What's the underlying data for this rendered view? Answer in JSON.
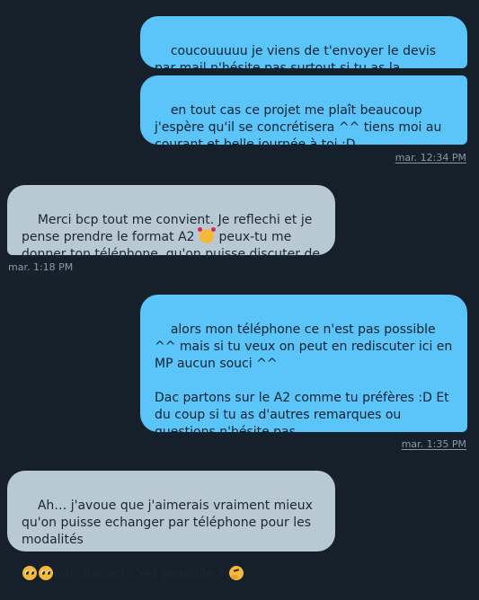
{
  "messages": [
    {
      "direction": "outgoing",
      "text": "coucouuuuu je viens de t'envoyer le devis par mail n'hésite pas surtout si tu as la moindre question :D"
    },
    {
      "direction": "outgoing",
      "text": "en tout cas ce projet me plaît beaucoup j'espère qu'il se concrétisera ^^ tiens moi au courant et belle journée à toi :D",
      "timestamp": "mar. 12:34 PM"
    },
    {
      "direction": "incoming",
      "text_before_emoji": "Merci bcp tout me convient. Je reflechi et je pense prendre le format A2 ",
      "emoji_1": "smiling-face-with-hearts",
      "text_after_emoji": " peux-tu me donner ton téléphone  qu'on puisse discuter de tout ca ?",
      "timestamp": "mar. 1:18 PM"
    },
    {
      "direction": "outgoing",
      "text": "alors mon téléphone ce n'est pas possible ^^ mais si tu veux on peut en rediscuter ici en MP aucun souci ^^\n\nDac partons sur le A2 comme tu préfères :D Et du coup si tu as d'autres remarques ou questions n'hésite pas",
      "timestamp": "mar. 1:35 PM"
    },
    {
      "direction": "incoming",
      "text_line_1": "Ah… j'avoue que j'aimerais vraiment mieux qu'on puisse echanger par téléphone pour les modalités",
      "emoji_1": "pleading-face",
      "emoji_2": "pleading-face",
      "text_line_2": "par discord c'est possible ? ",
      "emoji_3": "thinking-face"
    }
  ]
}
